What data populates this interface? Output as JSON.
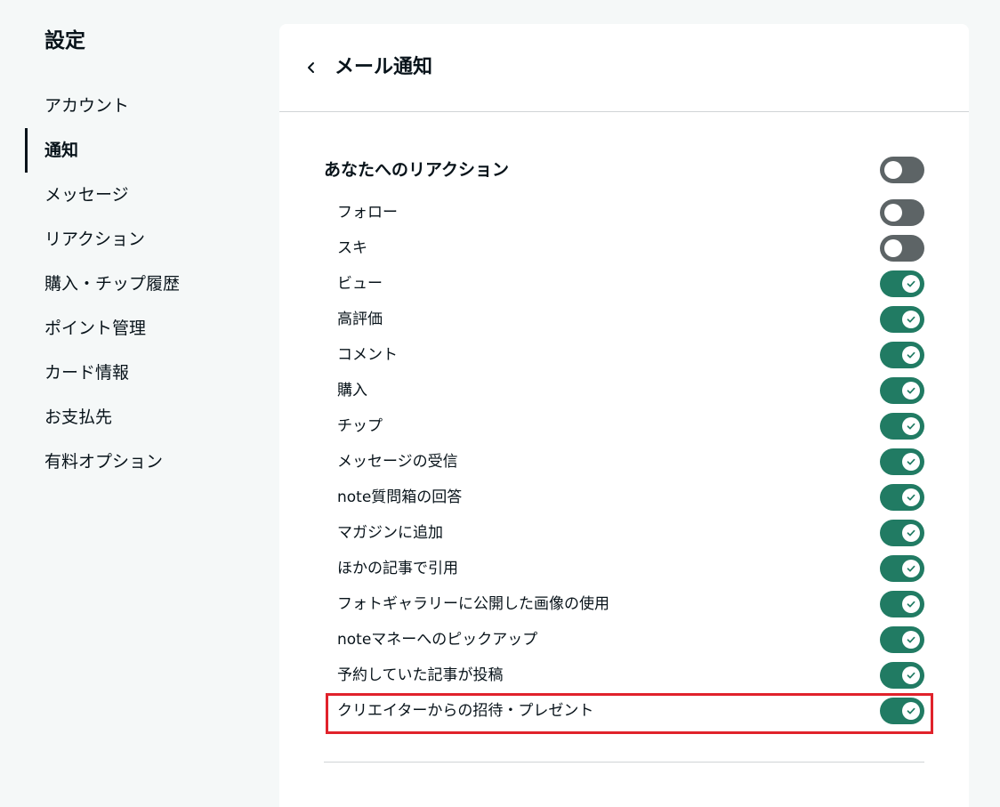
{
  "sidebar": {
    "title": "設定",
    "items": [
      {
        "label": "アカウント",
        "active": false
      },
      {
        "label": "通知",
        "active": true
      },
      {
        "label": "メッセージ",
        "active": false
      },
      {
        "label": "リアクション",
        "active": false
      },
      {
        "label": "購入・チップ履歴",
        "active": false
      },
      {
        "label": "ポイント管理",
        "active": false
      },
      {
        "label": "カード情報",
        "active": false
      },
      {
        "label": "お支払先",
        "active": false
      },
      {
        "label": "有料オプション",
        "active": false
      }
    ]
  },
  "panel": {
    "title": "メール通知",
    "section": {
      "label": "あなたへのリアクション",
      "enabled": false
    },
    "items": [
      {
        "label": "フォロー",
        "enabled": false
      },
      {
        "label": "スキ",
        "enabled": false
      },
      {
        "label": "ビュー",
        "enabled": true
      },
      {
        "label": "高評価",
        "enabled": true
      },
      {
        "label": "コメント",
        "enabled": true
      },
      {
        "label": "購入",
        "enabled": true
      },
      {
        "label": "チップ",
        "enabled": true
      },
      {
        "label": "メッセージの受信",
        "enabled": true
      },
      {
        "label": "note質問箱の回答",
        "enabled": true
      },
      {
        "label": "マガジンに追加",
        "enabled": true
      },
      {
        "label": "ほかの記事で引用",
        "enabled": true
      },
      {
        "label": "フォトギャラリーに公開した画像の使用",
        "enabled": true
      },
      {
        "label": "noteマネーへのピックアップ",
        "enabled": true
      },
      {
        "label": "予約していた記事が投稿",
        "enabled": true
      },
      {
        "label": "クリエイターからの招待・プレゼント",
        "enabled": true
      }
    ]
  },
  "icons": {
    "back": "chevron-left-icon",
    "check": "check-icon"
  },
  "colors": {
    "toggle_on": "#217b63",
    "toggle_off": "#5d6466",
    "highlight": "#e0222b"
  }
}
